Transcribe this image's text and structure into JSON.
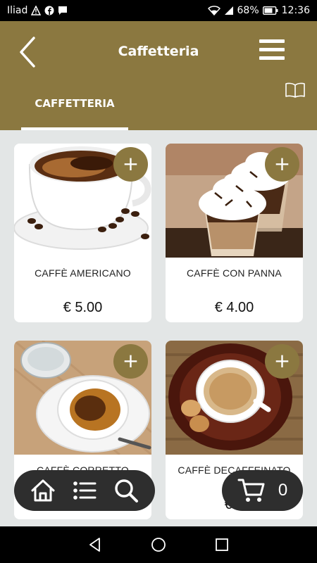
{
  "status_bar": {
    "carrier": "Iliad",
    "battery": "68%",
    "time": "12:36"
  },
  "header": {
    "title": "Caffetteria",
    "back_icon": "chevron-left-icon",
    "menu_icon": "hamburger-menu-icon",
    "book_icon": "open-book-icon"
  },
  "tabs": [
    {
      "label": "CAFFETTERIA",
      "active": true
    }
  ],
  "products": [
    {
      "name": "CAFFÈ AMERICANO",
      "price": "€ 5.00",
      "add": "+"
    },
    {
      "name": "CAFFÈ CON PANNA",
      "price": "€ 4.00",
      "add": "+"
    },
    {
      "name": "CAFFÈ CORRETTO",
      "price": "",
      "add": "+"
    },
    {
      "name": "CAFFÈ DECAFFEINATO",
      "price": "€ 3",
      "add": "+"
    }
  ],
  "bottom_nav": {
    "icons": [
      "home-icon",
      "list-icon",
      "search-icon"
    ],
    "cart_icon": "cart-icon",
    "cart_count": "0"
  },
  "colors": {
    "brand": "#8b7840",
    "background": "#e3e6e6",
    "nav_dark": "#2e2e2e"
  }
}
